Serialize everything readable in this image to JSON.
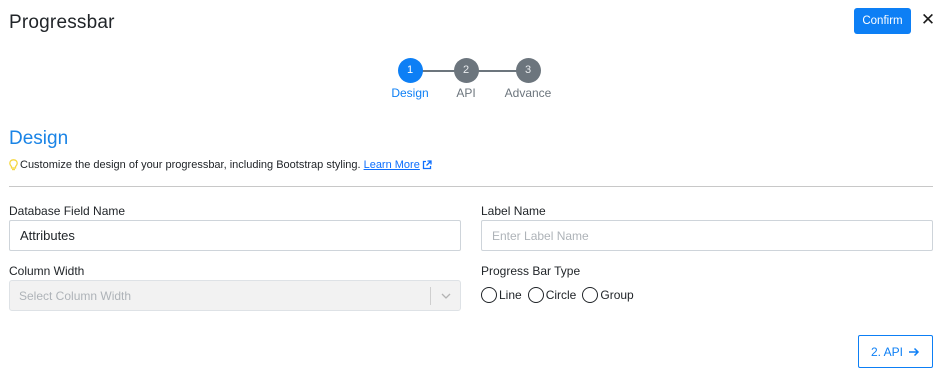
{
  "header": {
    "title": "Progressbar",
    "confirm_label": "Confirm",
    "close_glyph": "✕"
  },
  "stepper": {
    "steps": [
      {
        "number": "1",
        "label": "Design",
        "active": true
      },
      {
        "number": "2",
        "label": "API",
        "active": false
      },
      {
        "number": "3",
        "label": "Advance",
        "active": false
      }
    ]
  },
  "section": {
    "title": "Design",
    "hint_text": "Customize the design of your progressbar, including Bootstrap styling.",
    "learn_more": "Learn More",
    "hint_icon": "lightbulb-icon",
    "external_icon": "external-link-icon"
  },
  "form": {
    "db_field": {
      "label": "Database Field Name",
      "value": "Attributes"
    },
    "label_name": {
      "label": "Label Name",
      "placeholder": "Enter Label Name",
      "value": ""
    },
    "column_width": {
      "label": "Column Width",
      "placeholder": "Select Column Width"
    },
    "bar_type": {
      "label": "Progress Bar Type",
      "options": [
        "Line",
        "Circle",
        "Group"
      ]
    }
  },
  "footer": {
    "next_label": "2. API",
    "next_icon": "arrow-right-icon"
  },
  "colors": {
    "accent": "#0d7ff5",
    "section_title": "#1a84e6",
    "inactive_step": "#6c757d",
    "hint_icon": "#f5d742"
  }
}
